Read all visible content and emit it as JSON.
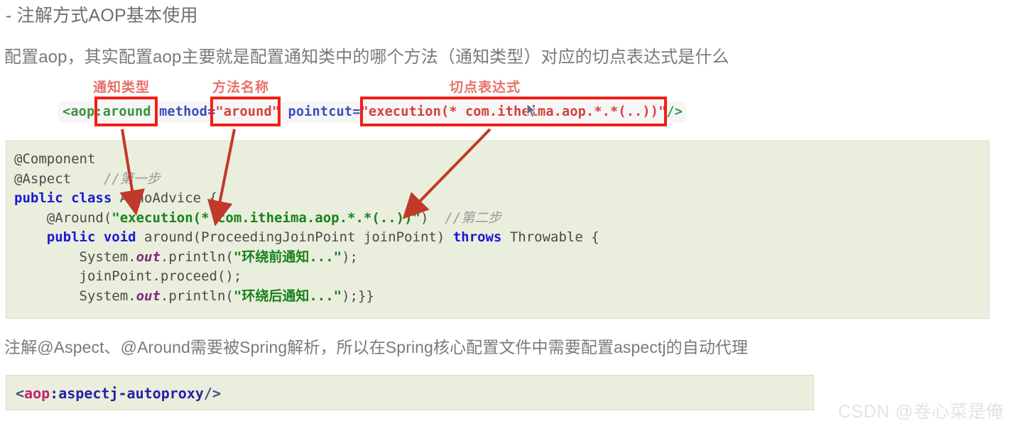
{
  "document": {
    "title": "- 注解方式AOP基本使用",
    "intro": "配置aop，其实配置aop主要就是配置通知类中的哪个方法（通知类型）对应的切点表达式是什么",
    "note": "注解@Aspect、@Around需要被Spring解析，所以在Spring核心配置文件中需要配置aspectj的自动代理"
  },
  "annotations": {
    "advice_type_label": "通知类型",
    "method_name_label": "方法名称",
    "pointcut_label": "切点表达式",
    "box_color": "#f41d16",
    "label_color": "#e8716b",
    "arrow_color": "#c0392b"
  },
  "xml_line": {
    "tag_open": "<aop",
    "advice_type": ":around",
    "method_attr": " method=",
    "method_value": "\"around\"",
    "pointcut_attr": " pointcut=",
    "pointcut_value": "\"execution(* com.itheima.aop.*.*(..))\"",
    "tag_close": "/>"
  },
  "java_code": {
    "line1": "@Component",
    "line2_code": "@Aspect",
    "line2_comment": "//第一步",
    "line3_kw": "public class",
    "line3_rest": " AnnoAdvice {",
    "line4_pre": "    @Around(",
    "line4_str": "\"execution(* com.itheima.aop.*.*(..))\"",
    "line4_post": ")  ",
    "line4_comment": "//第二步",
    "line5_kw": "public void",
    "line5_mid": " around(ProceedingJoinPoint joinPoint) ",
    "line5_kw2": "throws",
    "line5_end": " Throwable {",
    "line6_pre": "        System.",
    "line6_field": "out",
    "line6_mid": ".println(",
    "line6_str": "\"环绕前通知...\"",
    "line6_post": ");",
    "line7": "        joinPoint.proceed();",
    "line8_pre": "        System.",
    "line8_field": "out",
    "line8_mid": ".println(",
    "line8_str": "\"环绕后通知...\"",
    "line8_post": ");}}"
  },
  "xml_autoproxy": {
    "open": "<",
    "ns": "aop",
    "colon": ":",
    "name": "aspectj-autoproxy",
    "close": "/>"
  },
  "watermark": {
    "text": "CSDN @卷心菜是俺"
  }
}
